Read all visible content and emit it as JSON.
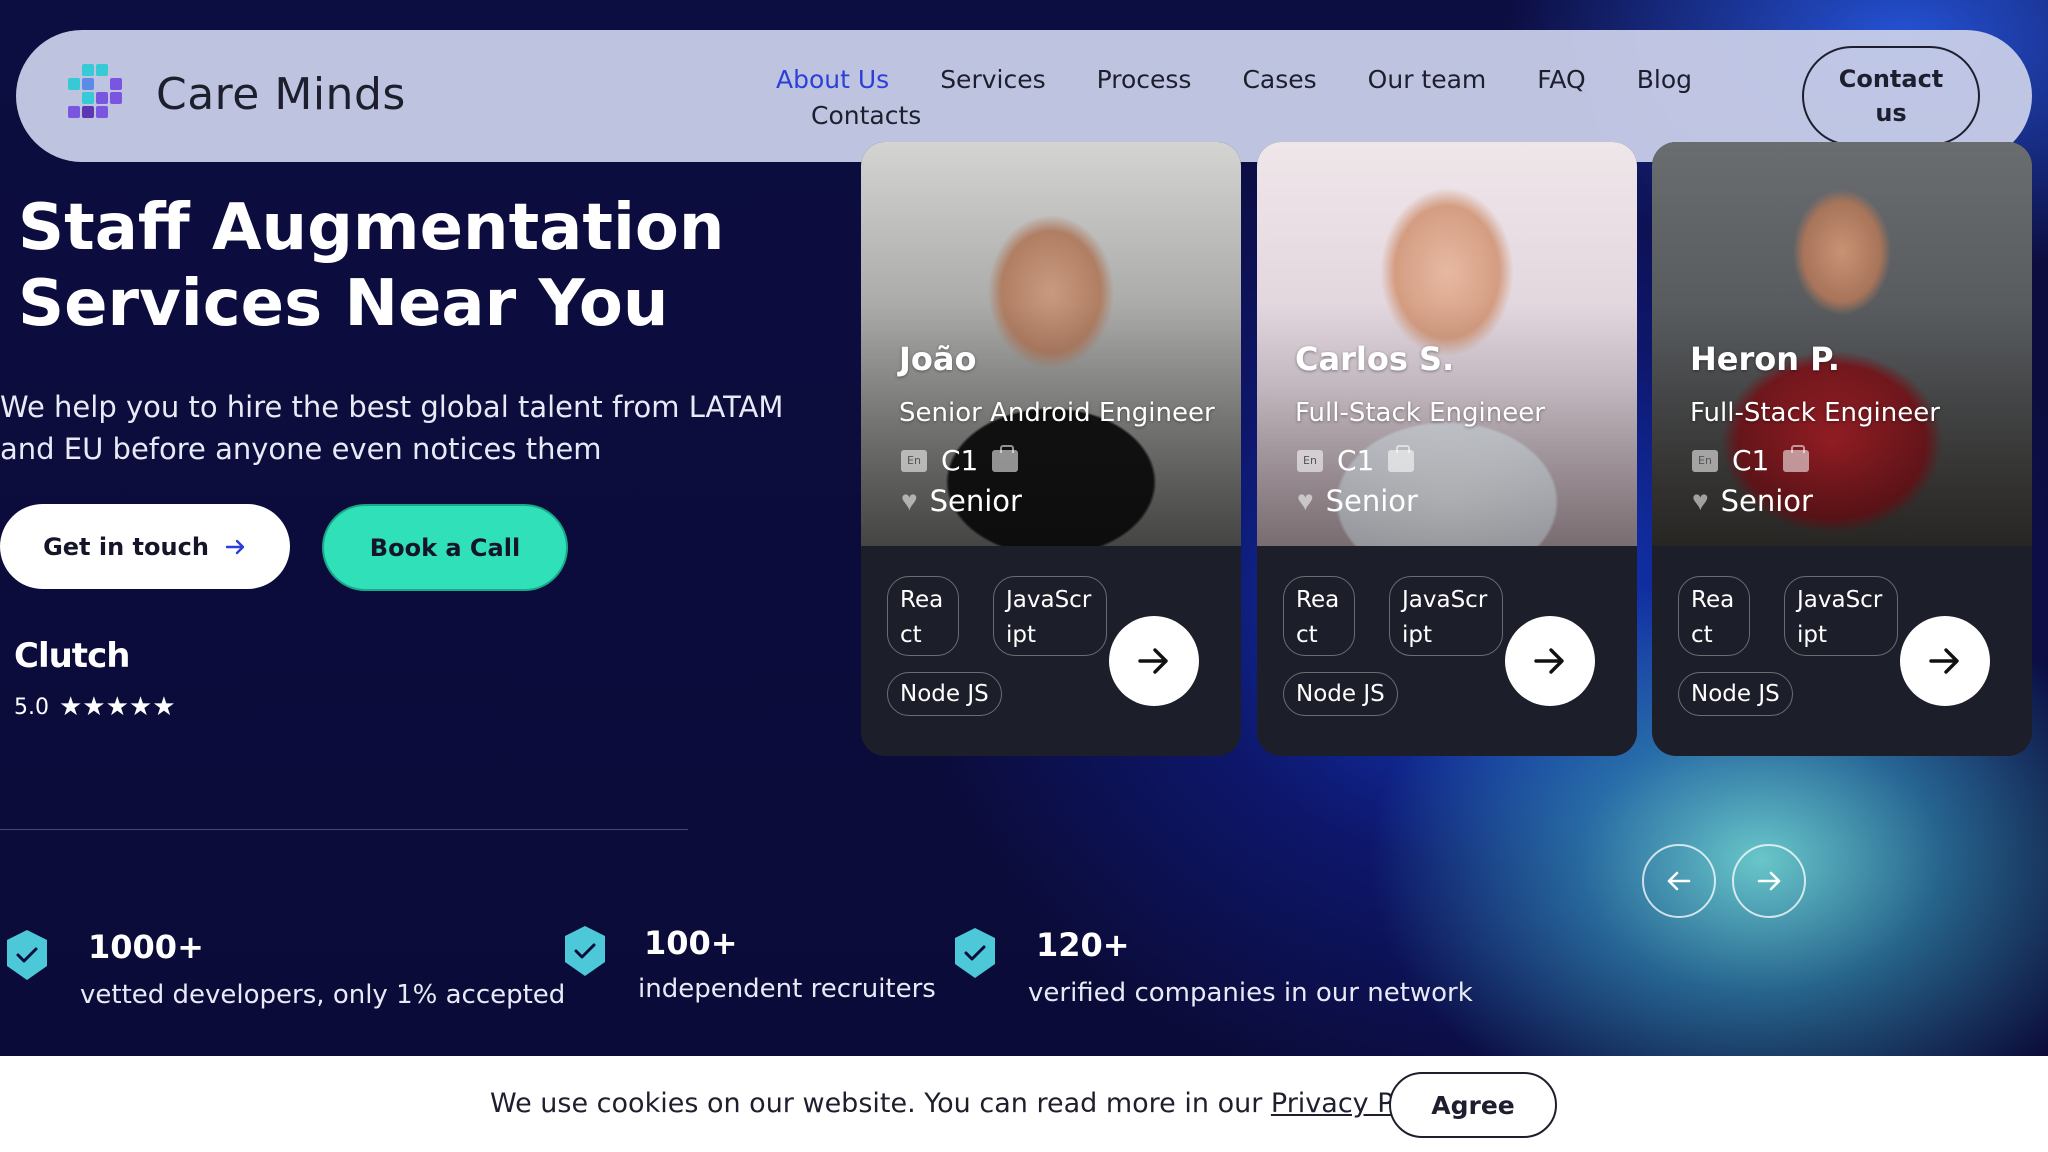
{
  "brand": {
    "name": "Care Minds"
  },
  "nav": {
    "items": [
      {
        "label": "About Us",
        "active": true
      },
      {
        "label": "Services"
      },
      {
        "label": "Process"
      },
      {
        "label": "Cases"
      },
      {
        "label": "Our team"
      },
      {
        "label": "FAQ"
      },
      {
        "label": "Blog"
      },
      {
        "label": "Contacts"
      }
    ],
    "contact_button": "Contact us"
  },
  "hero": {
    "title": "Staff Augmentation Services Near You",
    "subtitle": "We help you to hire the best global talent from LATAM and EU before anyone even notices them",
    "primary_button": "Get in touch",
    "secondary_button": "Book a Call"
  },
  "clutch": {
    "logo": "Clutch",
    "rating": "5.0",
    "stars": "★★★★★"
  },
  "stats": [
    {
      "value": "1000+",
      "label": "vetted developers, only 1% accepted"
    },
    {
      "value": "100+",
      "label": "independent recruiters"
    },
    {
      "value": "120+",
      "label": "verified companies in our network"
    }
  ],
  "cards": [
    {
      "name": "João",
      "role": "Senior Android Engineer",
      "lang_badge": "En",
      "language_level": "C1",
      "seniority": "Senior",
      "tags": [
        "Rea ct",
        "JavaScr ipt",
        "Node JS"
      ]
    },
    {
      "name": "Carlos S.",
      "role": "Full-Stack Engineer",
      "lang_badge": "En",
      "language_level": "C1",
      "seniority": "Senior",
      "tags": [
        "Rea ct",
        "JavaScr ipt",
        "Node JS"
      ]
    },
    {
      "name": "Heron P.",
      "role": "Full-Stack Engineer",
      "lang_badge": "En",
      "language_level": "C1",
      "seniority": "Senior",
      "tags": [
        "Rea ct",
        "JavaScr ipt",
        "Node JS"
      ]
    }
  ],
  "cookie": {
    "text": "We use cookies on our website. You can read more in our ",
    "link": "Privacy Policy",
    "suffix": ".",
    "button": "Agree"
  },
  "colors": {
    "accent_teal": "#2fe0b8",
    "nav_active": "#2b3fd9",
    "background": "#0b0c3a"
  },
  "icons": {
    "arrow_right": "arrow-right-icon",
    "arrow_left": "arrow-left-icon",
    "shield_check": "shield-check-icon",
    "star": "star-icon"
  }
}
